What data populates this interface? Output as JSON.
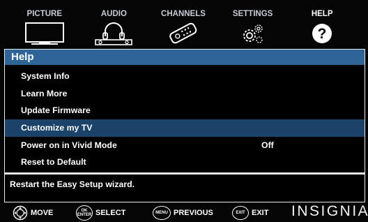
{
  "tabs": [
    {
      "label": "PICTURE",
      "icon": "tv-icon"
    },
    {
      "label": "AUDIO",
      "icon": "headphones-icon"
    },
    {
      "label": "CHANNELS",
      "icon": "remote-icon"
    },
    {
      "label": "SETTINGS",
      "icon": "gears-icon"
    },
    {
      "label": "HELP",
      "icon": "question-icon",
      "active": true
    }
  ],
  "panel": {
    "title": "Help",
    "items": [
      {
        "label": "System Info"
      },
      {
        "label": "Learn More"
      },
      {
        "label": "Update Firmware"
      },
      {
        "label": "Customize my TV",
        "selected": true
      },
      {
        "label": "Power on in Vivid Mode",
        "value": "Off"
      },
      {
        "label": "Reset to Default"
      }
    ],
    "help_text": "Restart the Easy Setup wizard."
  },
  "footer": {
    "move": {
      "label": "MOVE"
    },
    "select": {
      "label": "SELECT",
      "button": [
        "OK",
        "ENTER"
      ]
    },
    "previous": {
      "label": "PREVIOUS",
      "button": "MENU"
    },
    "exit": {
      "label": "EXIT",
      "button": "EXIT"
    },
    "brand": "INSIGNIA"
  },
  "colors": {
    "title_bar": "#2f6596",
    "selected_row": "#1b4268",
    "tab_text": "#c6ccd7"
  }
}
